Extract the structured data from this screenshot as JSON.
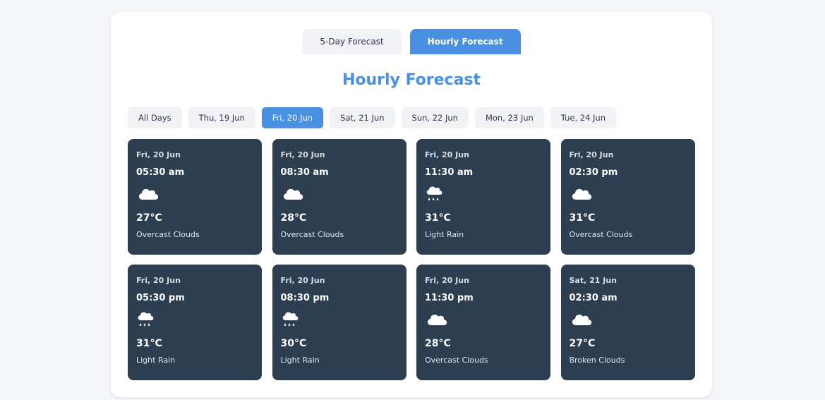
{
  "tabs": [
    {
      "label": "5-Day Forecast",
      "active": false
    },
    {
      "label": "Hourly Forecast",
      "active": true
    }
  ],
  "title": "Hourly Forecast",
  "day_filters": [
    {
      "label": "All Days",
      "active": false
    },
    {
      "label": "Thu, 19 Jun",
      "active": false
    },
    {
      "label": "Fri, 20 Jun",
      "active": true
    },
    {
      "label": "Sat, 21 Jun",
      "active": false
    },
    {
      "label": "Sun, 22 Jun",
      "active": false
    },
    {
      "label": "Mon, 23 Jun",
      "active": false
    },
    {
      "label": "Tue, 24 Jun",
      "active": false
    }
  ],
  "forecast": [
    {
      "date": "Fri, 20 Jun",
      "time": "05:30 am",
      "icon": "cloud-icon",
      "temp": "27°C",
      "desc": "Overcast Clouds"
    },
    {
      "date": "Fri, 20 Jun",
      "time": "08:30 am",
      "icon": "cloud-icon",
      "temp": "28°C",
      "desc": "Overcast Clouds"
    },
    {
      "date": "Fri, 20 Jun",
      "time": "11:30 am",
      "icon": "rain-cloud-icon",
      "temp": "31°C",
      "desc": "Light Rain"
    },
    {
      "date": "Fri, 20 Jun",
      "time": "02:30 pm",
      "icon": "cloud-icon",
      "temp": "31°C",
      "desc": "Overcast Clouds"
    },
    {
      "date": "Fri, 20 Jun",
      "time": "05:30 pm",
      "icon": "rain-cloud-icon",
      "temp": "31°C",
      "desc": "Light Rain"
    },
    {
      "date": "Fri, 20 Jun",
      "time": "08:30 pm",
      "icon": "rain-cloud-icon",
      "temp": "30°C",
      "desc": "Light Rain"
    },
    {
      "date": "Fri, 20 Jun",
      "time": "11:30 pm",
      "icon": "cloud-icon",
      "temp": "28°C",
      "desc": "Overcast Clouds"
    },
    {
      "date": "Sat, 21 Jun",
      "time": "02:30 am",
      "icon": "cloud-icon",
      "temp": "27°C",
      "desc": "Broken Clouds"
    }
  ],
  "colors": {
    "accent": "#4a90e2",
    "card_bg": "#2c3e50",
    "page_bg": "#f4f6fa"
  }
}
